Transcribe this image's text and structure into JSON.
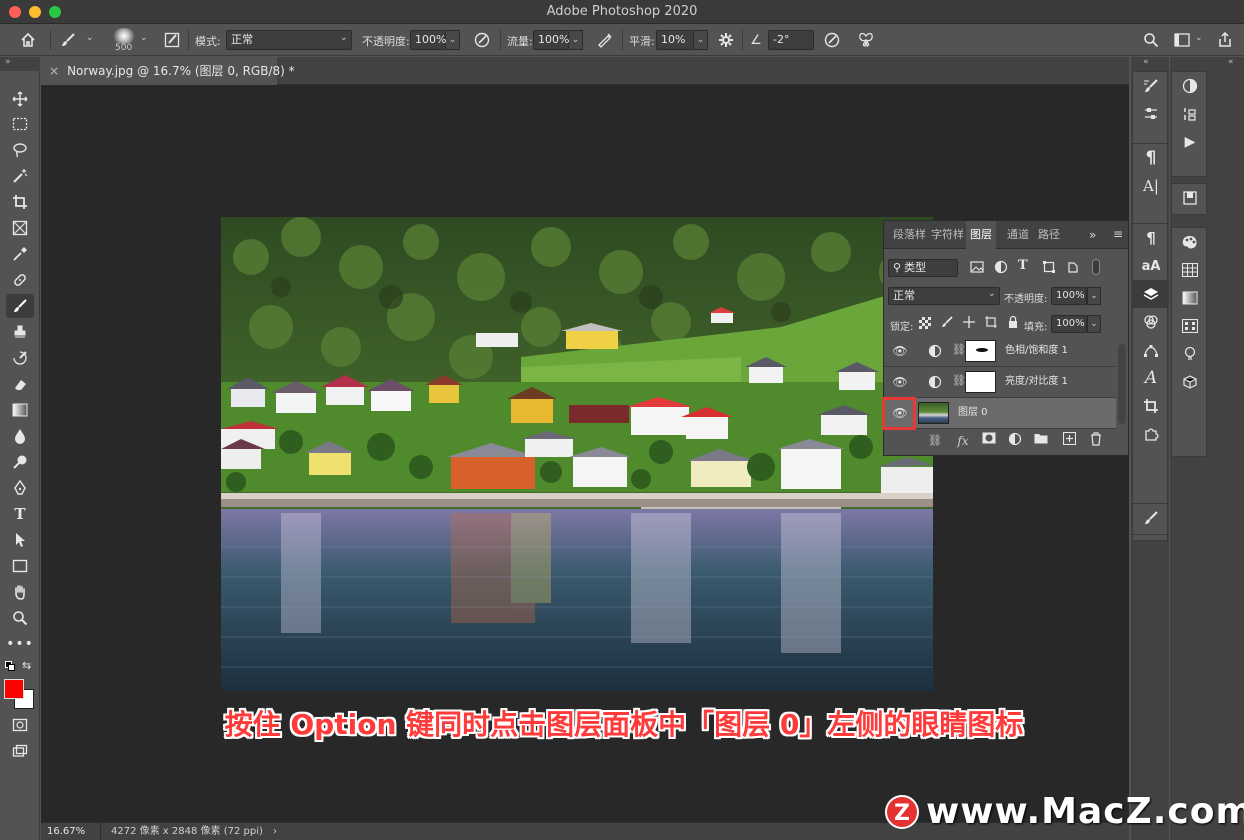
{
  "window": {
    "title": "Adobe Photoshop 2020"
  },
  "options_bar": {
    "brush_size": "500",
    "mode_label": "模式:",
    "mode_value": "正常",
    "opacity_label": "不透明度:",
    "opacity_value": "100%",
    "flow_label": "流量:",
    "flow_value": "100%",
    "smooth_label": "平滑:",
    "smooth_value": "10%",
    "angle_value": "-2°"
  },
  "document_tab": {
    "close": "×",
    "title": "Norway.jpg @ 16.7% (图层 0, RGB/8) *"
  },
  "status_bar": {
    "zoom": "16.67%",
    "info": "4272 像素 x 2848 像素 (72 ppi)",
    "arrow": "›"
  },
  "layers_panel": {
    "tabs": [
      "段落样",
      "字符样",
      "图层",
      "通道",
      "路径"
    ],
    "active_tab_index": 2,
    "filter_label": "类型",
    "blend_mode": "正常",
    "opacity_label": "不透明度:",
    "opacity_value": "100%",
    "lock_label": "锁定:",
    "fill_label": "填充:",
    "fill_value": "100%",
    "layers": [
      {
        "name": "色相/饱和度 1",
        "visible": true,
        "selected": false
      },
      {
        "name": "亮度/对比度 1",
        "visible": true,
        "selected": false
      },
      {
        "name": "图层 0",
        "visible": true,
        "selected": true
      }
    ],
    "footer_icons": [
      "link-icon",
      "fx-icon",
      "mask-icon",
      "adjustment-icon",
      "folder-icon",
      "new-layer-icon",
      "trash-icon"
    ],
    "fx_label": "fx"
  },
  "highlight_color": "#e53935",
  "caption": "按住 Option 键同时点击图层面板中「图层 0」左侧的眼睛图标",
  "watermark": {
    "logo": "Z",
    "text": "www.MacZ.com"
  }
}
